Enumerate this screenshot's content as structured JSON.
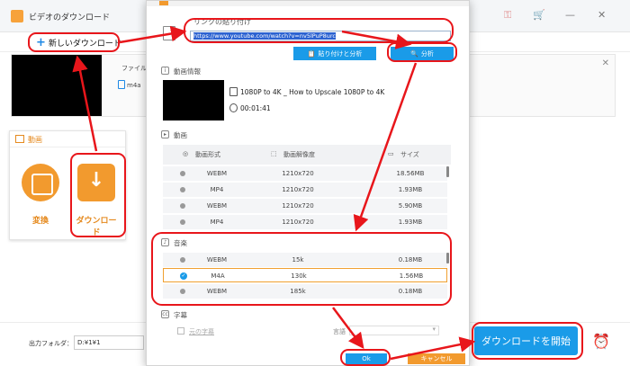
{
  "app": {
    "title": "ビデオのダウンロード",
    "new_download": "新しいダウンロード",
    "task": {
      "filename_label": "ファイル名",
      "format": "m4a"
    },
    "sidebar": {
      "header": "動画",
      "tools": [
        {
          "label": "変換",
          "icon": "film-convert-icon"
        },
        {
          "label": "ダウンロード",
          "icon": "download-icon"
        }
      ]
    },
    "output_folder_label": "出力フォルダ：",
    "output_folder_value": "D:¥1¥1",
    "start_download": "ダウンロードを開始"
  },
  "dialog": {
    "paste_label": "リンクの貼り付け",
    "url": "https://www.youtube.com/watch?v=nv5lPuP8urc",
    "btn_paste_analyze": "貼り付けと分析",
    "btn_analyze": "分析",
    "info_label": "動画情報",
    "video_title": "1080P to 4K _ How to Upscale 1080P to 4K",
    "duration": "00:01:41",
    "video_section": "動画",
    "columns": [
      "動画形式",
      "動画解像度",
      "サイズ"
    ],
    "video_rows": [
      {
        "format": "WEBM",
        "resolution": "1210x720",
        "size": "18.56MB"
      },
      {
        "format": "MP4",
        "resolution": "1210x720",
        "size": "1.93MB"
      },
      {
        "format": "WEBM",
        "resolution": "1210x720",
        "size": "5.90MB"
      },
      {
        "format": "MP4",
        "resolution": "1210x720",
        "size": "1.93MB"
      }
    ],
    "audio_section": "音楽",
    "audio_rows": [
      {
        "format": "WEBM",
        "bitrate": "15k",
        "size": "0.18MB",
        "selected": false
      },
      {
        "format": "M4A",
        "bitrate": "130k",
        "size": "1.56MB",
        "selected": true
      },
      {
        "format": "WEBM",
        "bitrate": "185k",
        "size": "0.18MB",
        "selected": false
      }
    ],
    "subtitle_section": "字幕",
    "original_subtitle": "元の字幕",
    "language_label": "言語",
    "btn_ok": "Ok",
    "btn_cancel": "キャンセル"
  },
  "colors": {
    "accent": "#1a9be8",
    "orange": "#f29a2e",
    "annotation": "#e8161b"
  }
}
